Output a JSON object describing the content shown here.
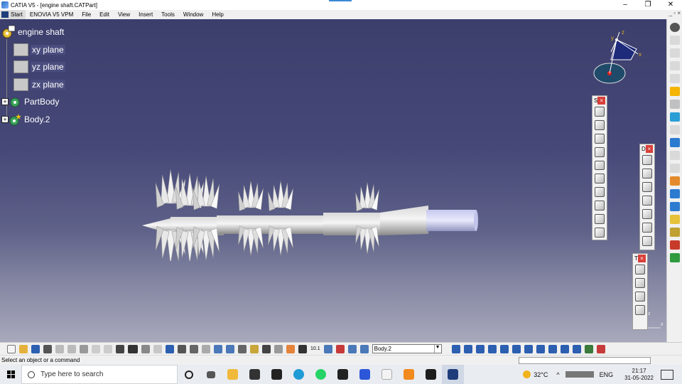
{
  "window": {
    "title": "CATIA V5 - [engine shaft.CATPart]",
    "controls": [
      "–",
      "❐",
      "✕"
    ],
    "mdi_controls": "_ ▫ ×"
  },
  "menubar": {
    "start": "Start",
    "items": [
      "ENOVIA V5 VPM",
      "File",
      "Edit",
      "View",
      "Insert",
      "Tools",
      "Window",
      "Help"
    ]
  },
  "tree": {
    "root": "engine shaft",
    "nodes": [
      {
        "label": "xy plane",
        "icon": "plane-icon"
      },
      {
        "label": "yz plane",
        "icon": "plane-icon"
      },
      {
        "label": "zx plane",
        "icon": "plane-icon"
      },
      {
        "label": "PartBody",
        "icon": "body-icon"
      },
      {
        "label": "Body.2",
        "icon": "body-icon"
      }
    ]
  },
  "compass": {
    "x": "x",
    "y": "y",
    "z": "z"
  },
  "axis_mini": {
    "z": "z",
    "x": "x"
  },
  "palettes": [
    {
      "id": "s",
      "label": "S",
      "close": "×",
      "tools": 10
    },
    {
      "id": "d",
      "label": "D",
      "close": "×",
      "tools": 7
    },
    {
      "id": "t",
      "label": "T",
      "close": "×",
      "tools": 4
    }
  ],
  "bottom_toolbar": {
    "current_body": "Body.2",
    "scale_label": "10.1"
  },
  "status": {
    "message": "Select an object or a command"
  },
  "taskbar": {
    "search_placeholder": "Type here to search",
    "weather": "32°C",
    "language": "ENG",
    "time": "21:17",
    "date": "31-05-2022"
  },
  "colors": {
    "viewport_top": "#3c3e6c",
    "viewport_bottom": "#a8a9bc",
    "close_red": "#d9403a"
  }
}
